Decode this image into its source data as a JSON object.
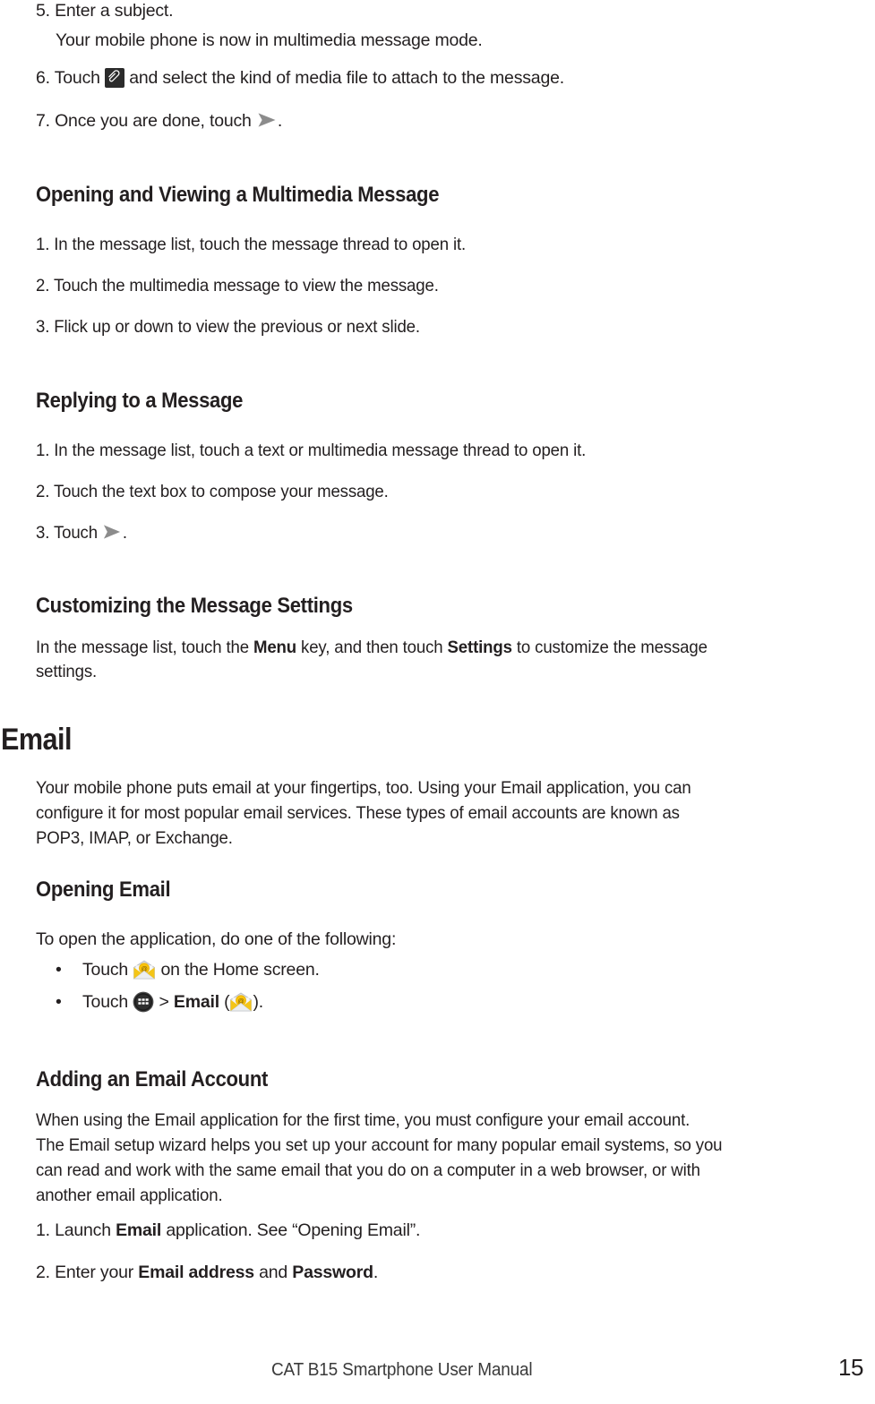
{
  "document": {
    "footer_title": "CAT B15 Smartphone User Manual",
    "page_number": "15"
  },
  "icons": {
    "attachment": "paperclip-icon",
    "send": "send-arrow-icon",
    "email_app": "email-envelope-icon",
    "app_drawer": "app-drawer-grid-icon"
  },
  "colors": {
    "text": "#231f20",
    "send_arrow": "#8c8c8c",
    "attach_bg": "#2b2b2b",
    "mail_yellow": "#f9c20a",
    "mail_envelope": "#e9eaec",
    "apps_dark": "#232323"
  },
  "steps_compose": {
    "step5_num": "5. Enter a subject.",
    "step5_sub": "Your mobile phone is now in multimedia message mode.",
    "step6_a": "6. Touch",
    "step6_b": "and select the kind of media file to attach to the message.",
    "step7_a": "7. Once you are done, touch",
    "step7_b": "."
  },
  "opening_viewing": {
    "heading": "Opening and Viewing a Multimedia Message",
    "items": [
      "1. In the message list, touch the message thread to open it.",
      "2. Touch the multimedia message to view the message.",
      "3. Flick up or down to view the previous or next slide."
    ]
  },
  "replying": {
    "heading": "Replying to a Message",
    "items": [
      "1. In the message list, touch a text or multimedia message thread to open it.",
      "2. Touch the text box to compose your message."
    ],
    "item3_a": "3. Touch",
    "item3_b": "."
  },
  "customizing": {
    "heading": "Customizing the Message Settings",
    "body_1": "In the message list, touch the ",
    "body_menu": "Menu",
    "body_2": " key, and then touch ",
    "body_settings": "Settings",
    "body_3": " to customize the message",
    "body_line2": "settings."
  },
  "email": {
    "heading": "Email",
    "intro_line1": "Your mobile phone puts email at your fingertips, too. Using your Email application, you can",
    "intro_line2": "configure it for most popular email services. These types of email accounts are known as",
    "intro_line3": "POP3, IMAP, or Exchange."
  },
  "opening_email": {
    "heading": "Opening Email",
    "lead": "To open the application, do one of the following:",
    "bullet_char": "•",
    "b1_a": "Touch",
    "b1_b": "on the Home screen.",
    "b2_a": "Touch",
    "b2_gt": ">",
    "b2_bold": "Email",
    "b2_open": "(",
    "b2_close": ")."
  },
  "adding_account": {
    "heading": "Adding an Email Account",
    "body_line1": "When using the Email application for the first time, you must configure your email account.",
    "body_line2": "The Email setup wizard helps you set up your account for many popular email systems, so you",
    "body_line3": "can read and work with the same email that you do on a computer in a web browser, or with",
    "body_line4": "another email application.",
    "step1_a": "1. Launch ",
    "step1_bold": "Email",
    "step1_b": " application. See “Opening Email”.",
    "step2_a": "2. Enter your ",
    "step2_bold1": "Email address",
    "step2_mid": " and ",
    "step2_bold2": "Password",
    "step2_end": "."
  }
}
